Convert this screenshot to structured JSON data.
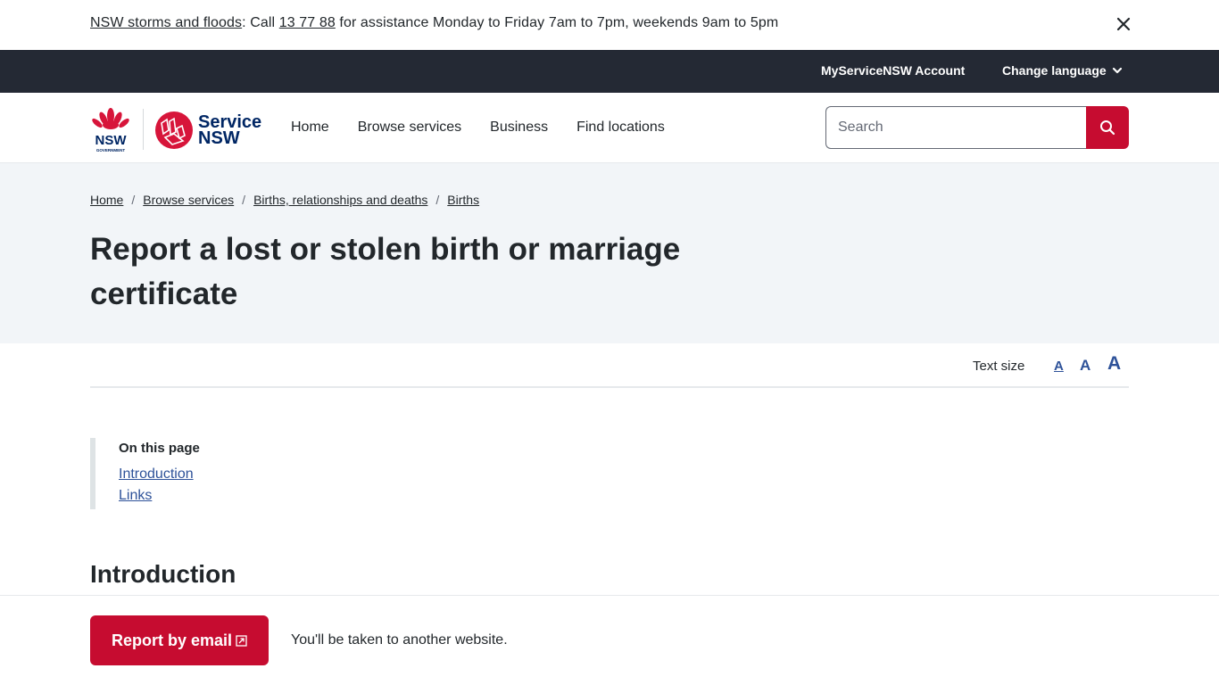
{
  "alert": {
    "link_text": "NSW storms and floods",
    "colon": ":",
    "call_text": " Call ",
    "phone": "13 77 88",
    "rest_text": " for assistance Monday to Friday 7am to 7pm, weekends 9am to 5pm",
    "close_icon": "close-icon"
  },
  "utility": {
    "account_label": "MyServiceNSW Account",
    "language_label": "Change language",
    "language_icon": "chevron-down-icon"
  },
  "header": {
    "logo_nsw_text": "NSW",
    "logo_nsw_sub": "GOVERNMENT",
    "logo_service_line1": "Service",
    "logo_service_line2": "NSW",
    "nav": [
      {
        "label": "Home"
      },
      {
        "label": "Browse services"
      },
      {
        "label": "Business"
      },
      {
        "label": "Find locations"
      }
    ],
    "search": {
      "placeholder": "Search",
      "value": "",
      "button_icon": "search-icon"
    }
  },
  "hero": {
    "breadcrumb": [
      {
        "label": "Home"
      },
      {
        "label": "Browse services"
      },
      {
        "label": "Births, relationships and deaths"
      },
      {
        "label": "Births"
      }
    ],
    "separator": "/",
    "title": "Report a lost or stolen birth or marriage certificate"
  },
  "text_size": {
    "label": "Text size",
    "small": "A",
    "medium": "A",
    "large": "A",
    "selected": "small"
  },
  "on_this_page": {
    "title": "On this page",
    "links": [
      {
        "label": "Introduction"
      },
      {
        "label": "Links"
      }
    ]
  },
  "content": {
    "intro_heading": "Introduction"
  },
  "footer_cta": {
    "button_label": "Report by email",
    "button_icon": "external-link-icon",
    "note": "You'll be taken to another website."
  },
  "colors": {
    "brand_red": "#c60c30",
    "brand_navy": "#002664",
    "link_blue": "#2e5299",
    "dark_bar": "#242934",
    "hero_bg": "#f2f5f8"
  }
}
